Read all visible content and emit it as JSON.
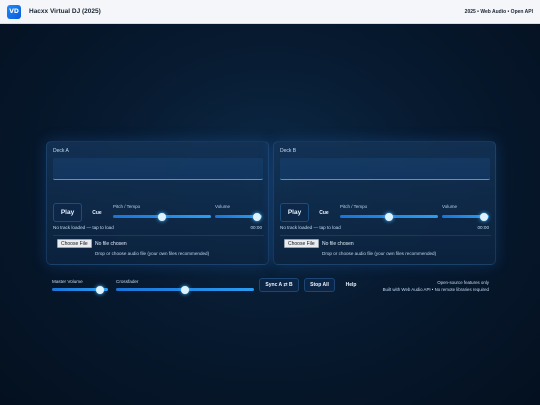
{
  "header": {
    "logo_text": "VD",
    "title": "Hacxx Virtual DJ (2025)",
    "right_text": "2025 • Web Audio • Open API"
  },
  "decks": [
    {
      "title": "Deck A",
      "play_label": "Play",
      "cue_label": "Cue",
      "pitch_label": "Pitch / Tempo",
      "volume_label": "Volume",
      "pitch_value": 0.5,
      "volume_value": 0.9,
      "status": "No track loaded — tap to load",
      "time": "00:00",
      "file_button": "Choose File",
      "file_status": "No file chosen",
      "file_hint": "Drop or choose audio file (your own files recommended)"
    },
    {
      "title": "Deck B",
      "play_label": "Play",
      "cue_label": "Cue",
      "pitch_label": "Pitch / Tempo",
      "volume_label": "Volume",
      "pitch_value": 0.5,
      "volume_value": 0.9,
      "status": "No track loaded — tap to load",
      "time": "00:00",
      "file_button": "Choose File",
      "file_status": "No file chosen",
      "file_hint": "Drop or choose audio file (your own files recommended)"
    }
  ],
  "mixer": {
    "master_label": "Master Volume",
    "master_value": 0.85,
    "crossfader_label": "Crossfader",
    "crossfader_value": 0.5,
    "sync_label": "Sync A ⇄ B",
    "stop_label": "Stop All",
    "help_label": "Help",
    "info_line1": "Open-source features only",
    "info_line2": "Built with Web Audio API • No remote libraries required"
  },
  "colors": {
    "accent": "#2b9cf0",
    "background": "#071a30",
    "header_bg": "#f4f6f9"
  }
}
